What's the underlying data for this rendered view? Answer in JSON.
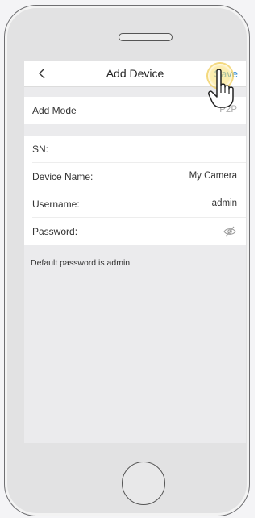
{
  "header": {
    "back_icon": "chevron-left-icon",
    "title": "Add Device",
    "save_label": "Save"
  },
  "rows": {
    "add_mode": {
      "label": "Add Mode",
      "value": "P2P"
    },
    "sn": {
      "label": "SN:",
      "value": ""
    },
    "device_name": {
      "label": "Device Name:",
      "value": "My Camera"
    },
    "username": {
      "label": "Username:",
      "value": "admin"
    },
    "password": {
      "label": "Password:",
      "value": "",
      "icon": "eye-slash-icon"
    }
  },
  "hint": "Default password is admin",
  "overlay": {
    "icon": "pointing-hand-icon"
  },
  "colors": {
    "accent": "#2f8bd6",
    "screen_bg": "#ebebed",
    "tap_highlight": "#f7dd7a"
  }
}
